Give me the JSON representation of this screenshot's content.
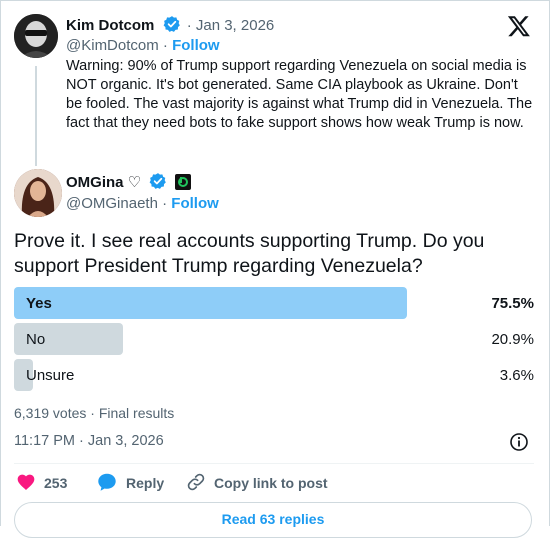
{
  "quoted_tweet": {
    "author_name": "Kim Dotcom",
    "date": "· Jan 3, 2026",
    "handle": "@KimDotcom",
    "separator": "·",
    "follow_label": "Follow",
    "text": "Warning: 90% of Trump support regarding Venezuela on social media is NOT organic. It's bot generated. Same CIA playbook as Ukraine. Don't be fooled. The vast majority is against what Trump did in Venezuela. The fact that they need bots to fake support shows how weak Trump is now."
  },
  "main_tweet": {
    "author_name": "OMGina ♡",
    "handle": "@OMGinaeth",
    "separator": "·",
    "follow_label": "Follow",
    "text": "Prove it. I see real accounts supporting Trump. Do you support President Trump regarding Venezuela?"
  },
  "poll": {
    "options": [
      {
        "label": "Yes",
        "percent_text": "75.5%",
        "fraction": 0.755,
        "leading": true
      },
      {
        "label": "No",
        "percent_text": "20.9%",
        "fraction": 0.209,
        "leading": false
      },
      {
        "label": "Unsure",
        "percent_text": "3.6%",
        "fraction": 0.036,
        "leading": false
      }
    ],
    "summary": "6,319 votes · Final results"
  },
  "timestamp": "11:17 PM · Jan 3, 2026",
  "actions": {
    "likes_count": "253",
    "reply_label": "Reply",
    "copy_link_label": "Copy link to post"
  },
  "read_replies_label": "Read 63 replies",
  "colors": {
    "accent": "#1d9bf0",
    "leading_bar": "#8ecdf8",
    "other_bar": "#cfd9de",
    "heart": "#f91880"
  },
  "icons": [
    "verified-badge-icon",
    "x-logo-icon",
    "info-icon",
    "heart-icon",
    "reply-bubble-icon",
    "link-icon",
    "green-badge-icon"
  ]
}
